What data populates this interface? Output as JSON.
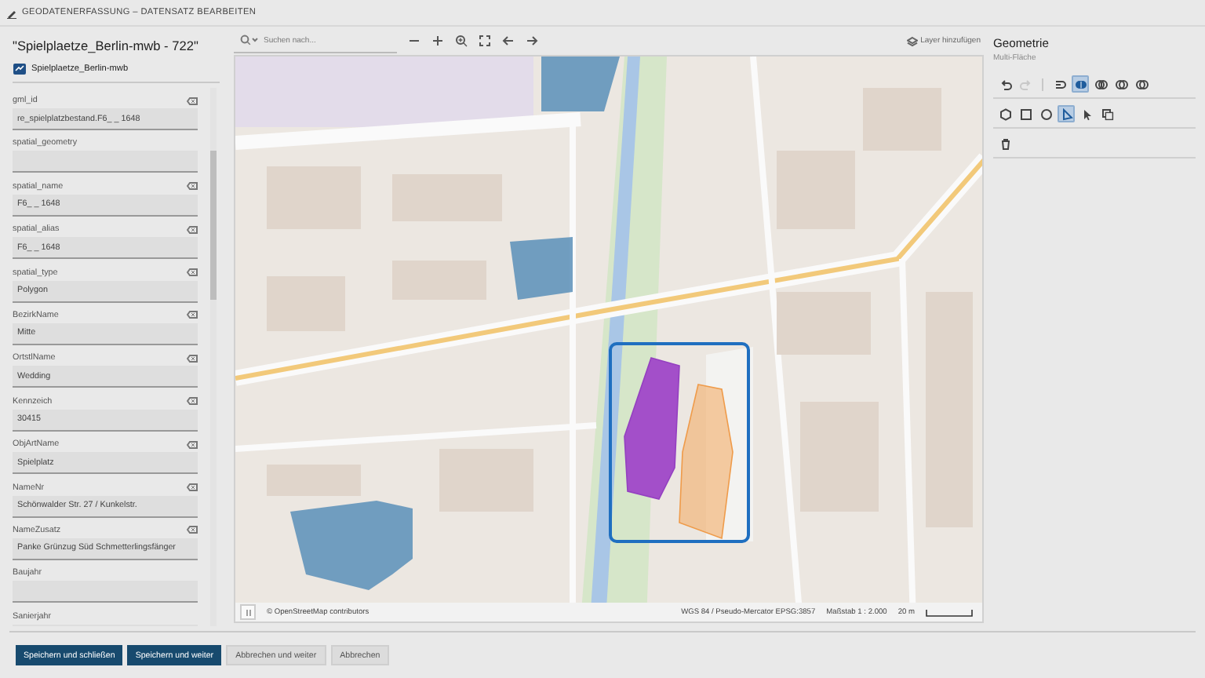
{
  "header": {
    "title": "GEODATENERFASSUNG – DATENSATZ BEARBEITEN"
  },
  "record": {
    "title": "\"Spielplaetze_Berlin-mwb - 722\"",
    "layer": "Spielplaetze_Berlin-mwb"
  },
  "fields": [
    {
      "label": "gml_id",
      "value": "re_spielplatzbestand.F6_ _ 1648",
      "clearable": true
    },
    {
      "label": "spatial_geometry",
      "clearable": false
    },
    {
      "label": "spatial_name",
      "value": "F6_ _ 1648",
      "clearable": true
    },
    {
      "label": "spatial_alias",
      "value": "F6_ _ 1648",
      "clearable": true
    },
    {
      "label": "spatial_type",
      "value": "Polygon",
      "clearable": true
    },
    {
      "label": "BezirkName",
      "value": "Mitte",
      "clearable": true
    },
    {
      "label": "OrtstlName",
      "value": "Wedding",
      "clearable": true
    },
    {
      "label": "Kennzeich",
      "value": "30415",
      "clearable": true
    },
    {
      "label": "ObjArtName",
      "value": "Spielplatz",
      "clearable": true
    },
    {
      "label": "NameNr",
      "value": "Schönwalder Str. 27 / Kunkelstr.",
      "clearable": true
    },
    {
      "label": "NameZusatz",
      "value": "Panke Grünzug Süd Schmetterlingsfänger",
      "clearable": true
    },
    {
      "label": "Baujahr",
      "clearable": false
    },
    {
      "label": "Sanierjahr",
      "clearable": false
    }
  ],
  "map": {
    "search_placeholder": "Suchen nach...",
    "tools": [
      {
        "kind": "minus"
      },
      {
        "kind": "plus"
      },
      {
        "kind": "zoom"
      },
      {
        "kind": "fullscreen"
      },
      {
        "kind": "back"
      },
      {
        "kind": "forward"
      }
    ],
    "layer_button": "Layer hinzufügen",
    "attribution": "© OpenStreetMap contributors",
    "projection": "WGS 84 / Pseudo-Mercator EPSG:3857",
    "scale": "Maßstab 1 : 2.000",
    "scale_bar": "20 m"
  },
  "geometry": {
    "title": "Geometrie",
    "subtitle": "Multi-Fläche",
    "tool_rows": [
      [
        {
          "kind": "undo",
          "selected": false,
          "disabled": false
        },
        {
          "kind": "redo",
          "selected": false,
          "disabled": true
        },
        {
          "kind": "hook",
          "selected": false,
          "disabled": false,
          "divider_before": true
        },
        {
          "kind": "union",
          "selected": true,
          "disabled": false
        },
        {
          "kind": "intersect",
          "selected": false,
          "disabled": false
        },
        {
          "kind": "difference",
          "selected": false,
          "disabled": false
        },
        {
          "kind": "xor",
          "selected": false,
          "disabled": false
        }
      ],
      [
        {
          "kind": "hexagon",
          "selected": false,
          "disabled": false
        },
        {
          "kind": "square",
          "selected": false,
          "disabled": false
        },
        {
          "kind": "circle",
          "selected": false,
          "disabled": false
        },
        {
          "kind": "draw",
          "selected": true,
          "disabled": false
        },
        {
          "kind": "pointer",
          "selected": false,
          "disabled": false
        },
        {
          "kind": "copy",
          "selected": false,
          "disabled": false
        }
      ],
      [
        {
          "kind": "trash",
          "selected": false,
          "disabled": false
        }
      ]
    ]
  },
  "buttons": [
    {
      "label": "Speichern und schließen",
      "kind": "primary"
    },
    {
      "label": "Speichern und weiter",
      "kind": "primary"
    },
    {
      "label": "Abbrechen und weiter",
      "kind": "secondary"
    },
    {
      "label": "Abbrechen",
      "kind": "secondary"
    }
  ]
}
